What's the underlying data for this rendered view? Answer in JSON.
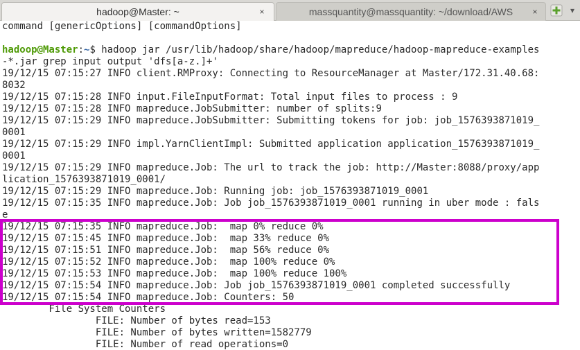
{
  "tabs": [
    {
      "title": "hadoop@Master: ~",
      "active": true,
      "close": "×"
    },
    {
      "title": "massquantity@massquantity: ~/download/AWS",
      "active": false,
      "close": "×"
    }
  ],
  "new_tab_icon": "plus-icon",
  "colors": {
    "prompt_user": "#4e9a06",
    "prompt_path": "#3465a4",
    "highlight_border": "#cc00cc",
    "new_tab_plus": "#5aa02c"
  },
  "terminal": {
    "lines": [
      {
        "text": "command [genericOptions] [commandOptions]"
      },
      {
        "text": ""
      },
      {
        "prompt_user": "hadoop@Master",
        "prompt_sep": ":",
        "prompt_path": "~",
        "text": "$ hadoop jar /usr/lib/hadoop/share/hadoop/mapreduce/hadoop-mapreduce-examples"
      },
      {
        "text": "-*.jar grep input output 'dfs[a-z.]+'"
      },
      {
        "text": "19/12/15 07:15:27 INFO client.RMProxy: Connecting to ResourceManager at Master/172.31.40.68:"
      },
      {
        "text": "8032"
      },
      {
        "text": "19/12/15 07:15:28 INFO input.FileInputFormat: Total input files to process : 9"
      },
      {
        "text": "19/12/15 07:15:28 INFO mapreduce.JobSubmitter: number of splits:9"
      },
      {
        "text": "19/12/15 07:15:29 INFO mapreduce.JobSubmitter: Submitting tokens for job: job_1576393871019_"
      },
      {
        "text": "0001"
      },
      {
        "text": "19/12/15 07:15:29 INFO impl.YarnClientImpl: Submitted application application_1576393871019_"
      },
      {
        "text": "0001"
      },
      {
        "text": "19/12/15 07:15:29 INFO mapreduce.Job: The url to track the job: http://Master:8088/proxy/app"
      },
      {
        "text": "lication_1576393871019_0001/"
      },
      {
        "text": "19/12/15 07:15:29 INFO mapreduce.Job: Running job: job_1576393871019_0001"
      },
      {
        "text": "19/12/15 07:15:35 INFO mapreduce.Job: Job job_1576393871019_0001 running in uber mode : fals"
      },
      {
        "text": "e"
      },
      {
        "text": "19/12/15 07:15:35 INFO mapreduce.Job:  map 0% reduce 0%"
      },
      {
        "text": "19/12/15 07:15:45 INFO mapreduce.Job:  map 33% reduce 0%"
      },
      {
        "text": "19/12/15 07:15:51 INFO mapreduce.Job:  map 56% reduce 0%"
      },
      {
        "text": "19/12/15 07:15:52 INFO mapreduce.Job:  map 100% reduce 0%"
      },
      {
        "text": "19/12/15 07:15:53 INFO mapreduce.Job:  map 100% reduce 100%"
      },
      {
        "text": "19/12/15 07:15:54 INFO mapreduce.Job: Job job_1576393871019_0001 completed successfully"
      },
      {
        "text": "19/12/15 07:15:54 INFO mapreduce.Job: Counters: 50"
      },
      {
        "text": "        File System Counters"
      },
      {
        "text": "                FILE: Number of bytes read=153"
      },
      {
        "text": "                FILE: Number of bytes written=1582779"
      },
      {
        "text": "                FILE: Number of read operations=0"
      }
    ]
  }
}
